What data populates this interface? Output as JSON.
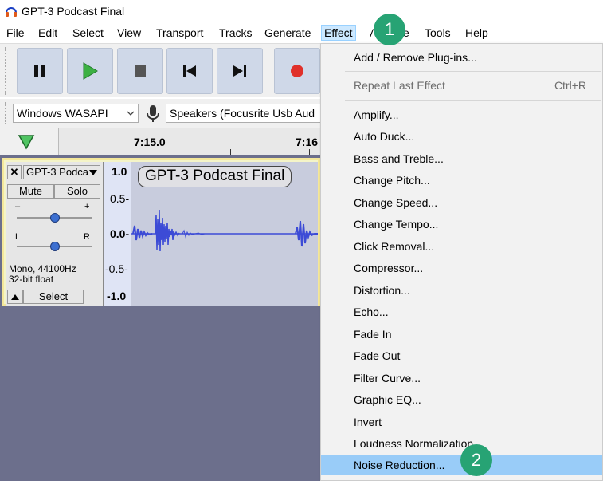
{
  "window": {
    "title": "GPT-3 Podcast Final",
    "app_icon": "headphones-icon"
  },
  "menubar": {
    "items": [
      "File",
      "Edit",
      "Select",
      "View",
      "Transport",
      "Tracks",
      "Generate",
      "Effect",
      "Analyze",
      "Tools",
      "Help"
    ],
    "visible": {
      "file": "File",
      "edit": "Edit",
      "select": "Select",
      "view": "View",
      "transport": "Transport",
      "tracks": "Tracks",
      "generate": "Generate",
      "effect": "Effect",
      "analyze_partial": "A",
      "analyze_tail": "e",
      "tools": "Tools",
      "help": "Help"
    }
  },
  "transport": {
    "buttons": [
      "pause-icon",
      "play-icon",
      "stop-icon",
      "skip-start-icon",
      "skip-end-icon",
      "record-icon"
    ]
  },
  "device": {
    "host": "Windows WASAPI",
    "output": "Speakers (Focusrite Usb Aud"
  },
  "timeline": {
    "label1": "7:15.0",
    "label2": "7:16"
  },
  "track": {
    "name": "GPT-3 Podca",
    "title_label": "GPT-3 Podcast Final",
    "mute": "Mute",
    "solo": "Solo",
    "gain_minus": "–",
    "gain_plus": "+",
    "pan_left": "L",
    "pan_right": "R",
    "info_line1": "Mono, 44100Hz",
    "info_line2": "32-bit float",
    "select": "Select",
    "scale": [
      "1.0",
      "0.5-",
      "0.0-",
      "-0.5-",
      "-1.0"
    ]
  },
  "effect_menu": {
    "add_remove": "Add / Remove Plug-ins...",
    "repeat_last": "Repeat Last Effect",
    "repeat_shortcut": "Ctrl+R",
    "items": [
      "Amplify...",
      "Auto Duck...",
      "Bass and Treble...",
      "Change Pitch...",
      "Change Speed...",
      "Change Tempo...",
      "Click Removal...",
      "Compressor...",
      "Distortion...",
      "Echo...",
      "Fade In",
      "Fade Out",
      "Filter Curve...",
      "Graphic EQ...",
      "Invert",
      "Loudness Normalization...",
      "Noise Reduction..."
    ]
  },
  "badges": {
    "step1": "1",
    "step2": "2"
  },
  "colors": {
    "badge_green": "#27a374",
    "highlight_blue": "#99ccf8",
    "waveform_blue": "#3c4bd6",
    "record_red": "#e0302a",
    "play_green": "#3cb043"
  }
}
